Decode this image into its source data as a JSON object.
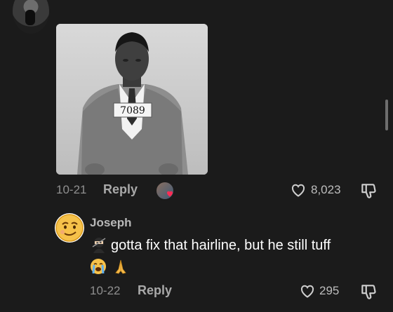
{
  "thread": {
    "post": {
      "date": "10-21",
      "reply_label": "Reply",
      "like_count": "8,023",
      "photo_placard": "7089"
    },
    "reply": {
      "username": "Joseph",
      "text": "gotta fix that hairline, but he still tuff",
      "date": "10-22",
      "reply_label": "Reply",
      "like_count": "295"
    }
  },
  "icons": {
    "like": "heart-outline-icon",
    "dislike": "thumbs-down-icon",
    "creator_liked": "red-heart-icon"
  },
  "colors": {
    "background": "#1b1b1b",
    "muted_text": "#8f8f8f",
    "creator_heart": "#fe2c55"
  }
}
